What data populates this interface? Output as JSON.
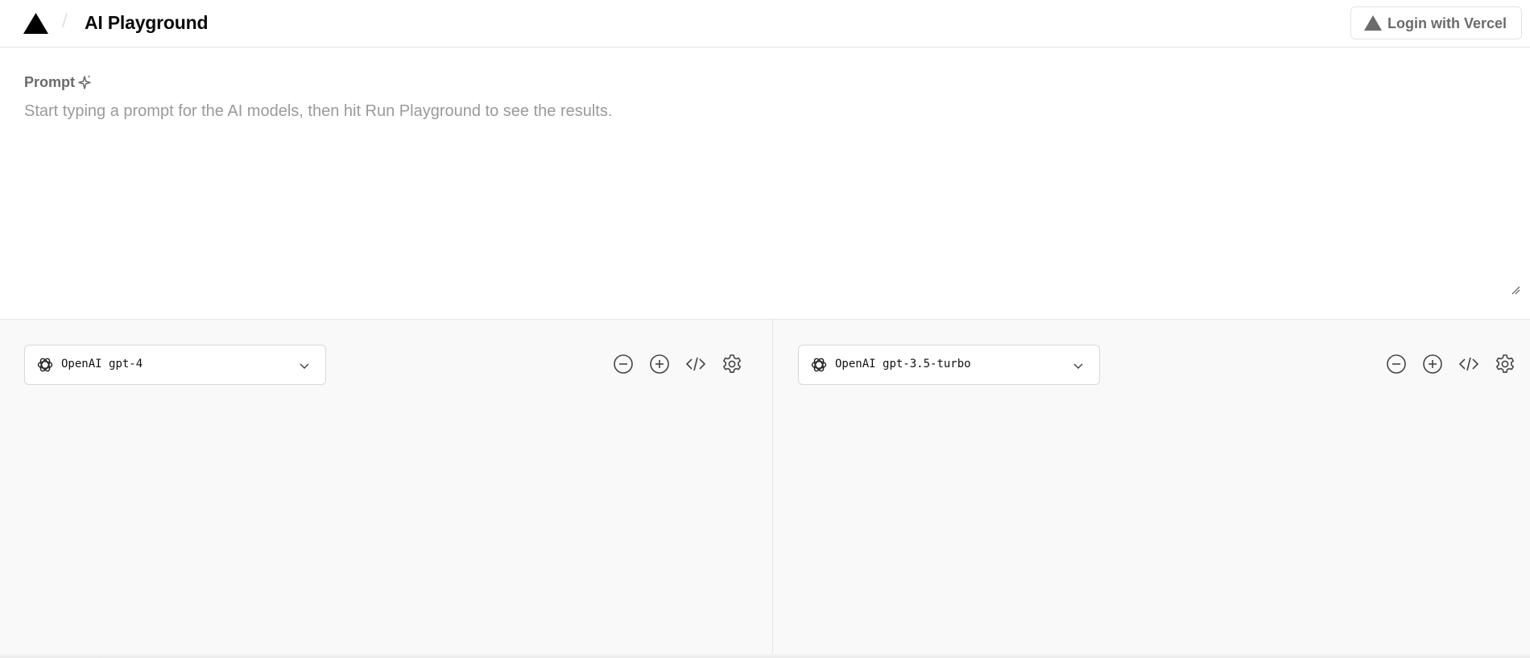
{
  "header": {
    "title": "AI Playground",
    "separator": "/",
    "login_label": "Login with Vercel"
  },
  "prompt": {
    "label": "Prompt",
    "placeholder": "Start typing a prompt for the AI models, then hit Run Playground to see the results.",
    "value": ""
  },
  "panels": [
    {
      "provider": "OpenAI",
      "model": "gpt-4",
      "tools": [
        "remove-icon",
        "add-icon",
        "code-icon",
        "gear-icon"
      ]
    },
    {
      "provider": "OpenAI",
      "model": "gpt-3.5-turbo",
      "tools": [
        "remove-icon",
        "add-icon",
        "code-icon",
        "gear-icon"
      ]
    }
  ],
  "colors": {
    "text_dark": "#0a0a0a",
    "text_muted": "#6b6b6b",
    "placeholder": "#9a9a9a",
    "border": "#e5e5e5",
    "panel_bg": "#f9f9f9"
  }
}
